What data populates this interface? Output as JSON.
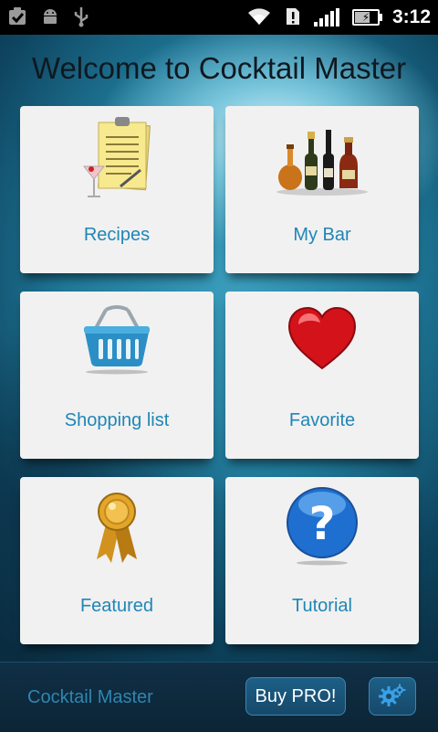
{
  "status_bar": {
    "time": "3:12",
    "left_icons": [
      "checkbox-icon",
      "android-icon",
      "usb-icon"
    ],
    "right_icons": [
      "wifi-icon",
      "sim-alert-icon",
      "signal-icon",
      "battery-charging-icon"
    ],
    "battery_level": 0.6
  },
  "header": {
    "title": "Welcome to Cocktail Master"
  },
  "tiles": [
    {
      "label": "Recipes",
      "icon": "recipe-notepad-icon"
    },
    {
      "label": "My Bar",
      "icon": "bottles-icon"
    },
    {
      "label": "Shopping list",
      "icon": "shopping-basket-icon"
    },
    {
      "label": "Favorite",
      "icon": "heart-icon"
    },
    {
      "label": "Featured",
      "icon": "award-ribbon-icon"
    },
    {
      "label": "Tutorial",
      "icon": "help-question-icon"
    }
  ],
  "bottom_bar": {
    "app_name": "Cocktail Master",
    "buy_label": "Buy PRO!",
    "settings_icon": "gears-icon"
  },
  "colors": {
    "tile_background": "#f1f1f1",
    "tile_label": "#1f86b6",
    "bottom_bar_button": "#1d5f86",
    "title_text": "#101820"
  }
}
